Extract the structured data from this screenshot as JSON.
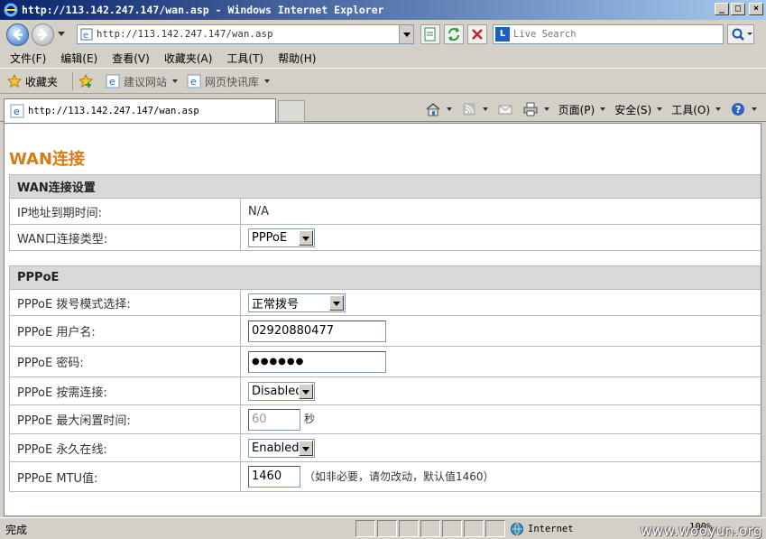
{
  "window": {
    "title": "http://113.142.247.147/wan.asp - Windows Internet Explorer",
    "min": "_",
    "max": "□",
    "close": "×"
  },
  "address": {
    "url": "http://113.142.247.147/wan.asp"
  },
  "search": {
    "placeholder": "Live Search"
  },
  "menu": {
    "items": [
      "文件(F)",
      "编辑(E)",
      "查看(V)",
      "收藏夹(A)",
      "工具(T)",
      "帮助(H)"
    ]
  },
  "favorites": {
    "label": "收藏夹",
    "suggested": "建议网站",
    "slices": "网页快讯库"
  },
  "tab": {
    "title": "http://113.142.247.147/wan.asp"
  },
  "command": {
    "page": "页面(P)",
    "safety": "安全(S)",
    "tools": "工具(O)"
  },
  "page": {
    "title": "WAN连接",
    "wan_section": {
      "header": "WAN连接设置",
      "rows": [
        {
          "label": "IP地址到期时间:",
          "value": "N/A"
        },
        {
          "label": "WAN口连接类型:",
          "value": "PPPoE"
        }
      ]
    },
    "pppoe_section": {
      "header": "PPPoE",
      "dial_mode": {
        "label": "PPPoE 拨号模式选择:",
        "value": "正常拨号"
      },
      "username": {
        "label": "PPPoE 用户名:",
        "value": "02920880477"
      },
      "password": {
        "label": "PPPoE 密码:",
        "value": "●●●●●●"
      },
      "on_demand": {
        "label": "PPPoE 按需连接:",
        "value": "Disabled"
      },
      "idle_time": {
        "label": "PPPoE 最大闲置时间:",
        "value": "60",
        "unit": "秒"
      },
      "always_on": {
        "label": "PPPoE 永久在线:",
        "value": "Enabled"
      },
      "mtu": {
        "label": "PPPoE MTU值:",
        "value": "1460",
        "hint": "（如非必要，请勿改动，默认值1460）"
      }
    }
  },
  "status": {
    "text": "完成",
    "zone": "Internet",
    "zoom": "100%",
    "watermark": "www.wooyun.org"
  },
  "colors": {
    "accent": "#d67b15",
    "header_bg": "#d9d9d9",
    "title_bar": "#0a246a"
  }
}
